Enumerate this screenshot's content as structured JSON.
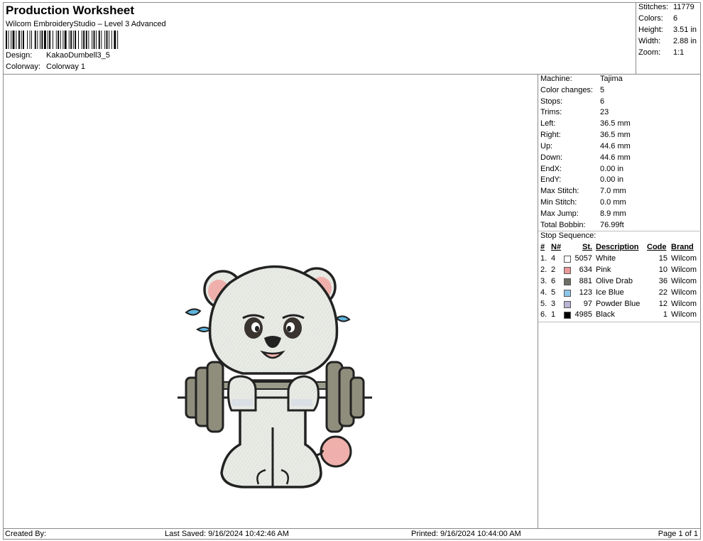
{
  "header": {
    "title": "Production Worksheet",
    "software": "Wilcom EmbroideryStudio – Level 3 Advanced",
    "design_label": "Design:",
    "design_value": "KakaoDumbell3_5",
    "colorway_label": "Colorway:",
    "colorway_value": "Colorway 1"
  },
  "stats": [
    {
      "label": "Stitches:",
      "value": "11779"
    },
    {
      "label": "Colors:",
      "value": "6"
    },
    {
      "label": "Height:",
      "value": "3.51 in"
    },
    {
      "label": "Width:",
      "value": "2.88 in"
    },
    {
      "label": "Zoom:",
      "value": "1:1"
    }
  ],
  "properties": [
    {
      "label": "Machine:",
      "value": "Tajima"
    },
    {
      "label": "Color changes:",
      "value": "5"
    },
    {
      "label": "Stops:",
      "value": "6"
    },
    {
      "label": "Trims:",
      "value": "23"
    },
    {
      "label": "Left:",
      "value": "36.5 mm"
    },
    {
      "label": "Right:",
      "value": "36.5 mm"
    },
    {
      "label": "Up:",
      "value": "44.6 mm"
    },
    {
      "label": "Down:",
      "value": "44.6 mm"
    },
    {
      "label": "EndX:",
      "value": "0.00 in"
    },
    {
      "label": "EndY:",
      "value": "0.00 in"
    },
    {
      "label": "Max Stitch:",
      "value": "7.0 mm"
    },
    {
      "label": "Min Stitch:",
      "value": "0.0 mm"
    },
    {
      "label": "Max Jump:",
      "value": "8.9 mm"
    },
    {
      "label": "Total Bobbin:",
      "value": "76.99ft"
    }
  ],
  "stop_sequence": {
    "title": "Stop Sequence:",
    "headers": {
      "num": "#",
      "n": "N#",
      "st": "St.",
      "desc": "Description",
      "code": "Code",
      "brand": "Brand"
    },
    "rows": [
      {
        "num": "1.",
        "n": "4",
        "color": "#ffffff",
        "st": "5057",
        "desc": "White",
        "code": "15",
        "brand": "Wilcom"
      },
      {
        "num": "2.",
        "n": "2",
        "color": "#e89a9a",
        "st": "634",
        "desc": "Pink",
        "code": "10",
        "brand": "Wilcom"
      },
      {
        "num": "3.",
        "n": "6",
        "color": "#6e6e66",
        "st": "881",
        "desc": "Olive Drab",
        "code": "36",
        "brand": "Wilcom"
      },
      {
        "num": "4.",
        "n": "5",
        "color": "#8ec6ea",
        "st": "123",
        "desc": "Ice Blue",
        "code": "22",
        "brand": "Wilcom"
      },
      {
        "num": "5.",
        "n": "3",
        "color": "#b7b4d6",
        "st": "97",
        "desc": "Powder Blue",
        "code": "12",
        "brand": "Wilcom"
      },
      {
        "num": "6.",
        "n": "1",
        "color": "#000000",
        "st": "4985",
        "desc": "Black",
        "code": "1",
        "brand": "Wilcom"
      }
    ]
  },
  "footer": {
    "created_by": "Created By:",
    "last_saved": "Last Saved: 9/16/2024 10:42:46 AM",
    "printed": "Printed: 9/16/2024 10:44:00 AM",
    "page": "Page 1 of 1"
  }
}
